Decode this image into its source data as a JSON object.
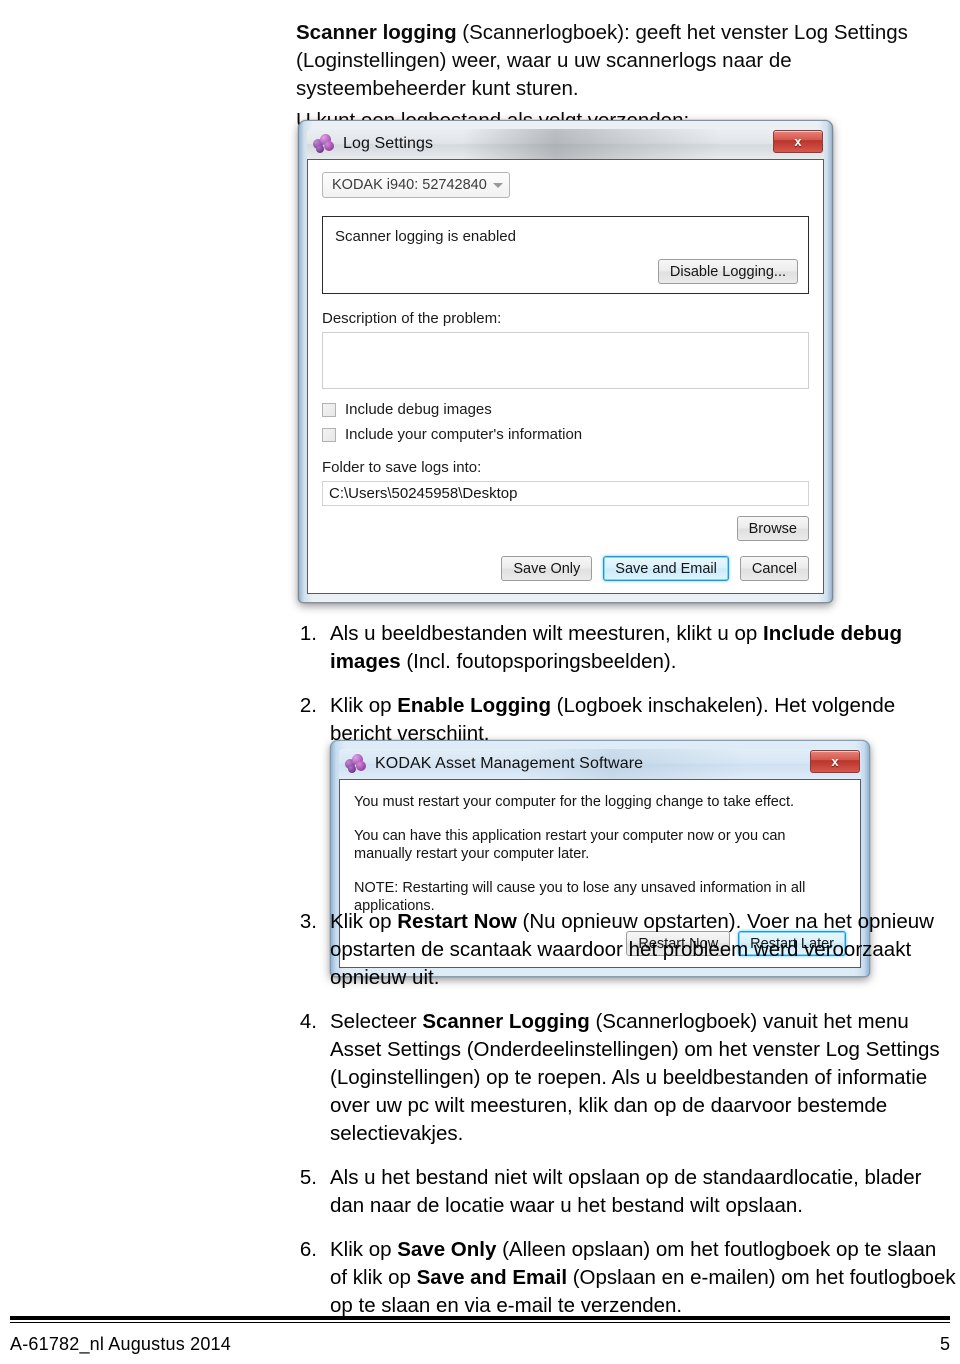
{
  "document": {
    "intro": {
      "scanner_logging_bold": "Scanner logging",
      "scanner_logging_rest": " (Scannerlogboek): geeft het venster Log Settings (Loginstellingen) weer, waar u uw scannerlogs naar de systeembeheerder kunt sturen.",
      "send_log": "U kunt een logbestand als volgt verzenden:"
    },
    "steps_top": [
      {
        "number": "1.",
        "text_before": "Als u beeldbestanden wilt meesturen, klikt u op ",
        "bold": "Include debug images",
        "text_after": " (Incl. foutopsporingsbeelden)."
      },
      {
        "number": "2.",
        "text_before": "Klik op ",
        "bold": "Enable Logging",
        "text_after": " (Logboek inschakelen). Het volgende bericht verschijnt."
      }
    ],
    "steps_bottom": [
      {
        "number": "3.",
        "text_before": "Klik op ",
        "bold": "Restart Now",
        "text_after": " (Nu opnieuw opstarten). Voer na het opnieuw opstarten de scantaak waardoor het probleem werd veroorzaakt opnieuw uit."
      },
      {
        "number": "4.",
        "text_before": "Selecteer ",
        "bold": "Scanner Logging",
        "text_after": " (Scannerlogboek) vanuit het menu Asset Settings (Onderdeelinstellingen) om het venster Log Settings (Loginstellingen) op te roepen. Als u beeldbestanden of informatie over uw pc wilt meesturen, klik dan op de daarvoor bestemde selectievakjes."
      },
      {
        "number": "5.",
        "text_before": "Als u het bestand niet wilt opslaan op de standaardlocatie, blader dan naar de locatie waar u het bestand wilt opslaan.",
        "bold": "",
        "text_after": ""
      },
      {
        "number": "6.",
        "text_before": "Klik op ",
        "bold": "Save Only",
        "text_mid": " (Alleen opslaan) om het foutlogboek op te slaan of klik op ",
        "bold2": "Save and Email",
        "text_after": " (Opslaan en e-mailen) om het foutlogboek op te slaan en via e-mail te verzenden."
      }
    ],
    "footer": {
      "left": "A-61782_nl  Augustus 2014",
      "page_number": "5"
    }
  },
  "log_settings_dialog": {
    "title": "Log Settings",
    "icon": "kodak-spheres-icon",
    "close_label": "x",
    "scanner_select": {
      "value": "KODAK i940: 52742840"
    },
    "status_group": {
      "status_text": "Scanner logging is enabled",
      "toggle_button": "Disable Logging..."
    },
    "description_label": "Description of the problem:",
    "description_value": "",
    "checkboxes": [
      {
        "label": "Include debug images",
        "checked": false
      },
      {
        "label": "Include your computer's information",
        "checked": false
      }
    ],
    "folder_label": "Folder to save logs into:",
    "folder_value": "C:\\Users\\50245958\\Desktop",
    "browse_button": "Browse",
    "buttons": [
      {
        "label": "Save Only",
        "default": false
      },
      {
        "label": "Save and Email",
        "default": true
      },
      {
        "label": "Cancel",
        "default": false
      }
    ]
  },
  "restart_dialog": {
    "title": "KODAK Asset Management Software",
    "icon": "kodak-spheres-icon",
    "close_label": "x",
    "lines": [
      "You must restart your computer for the logging change to take effect.",
      "You can have this application restart your computer now or you can manually restart your computer later.",
      "NOTE: Restarting will cause you to lose any unsaved information in all applications."
    ],
    "buttons": [
      {
        "label": "Restart Now",
        "default": false
      },
      {
        "label": "Restart Later",
        "default": true
      }
    ]
  },
  "colors": {
    "close_red": "#c0392b",
    "focus_blue": "#1a9bd7",
    "icon_purple": "#8e2f9e"
  }
}
